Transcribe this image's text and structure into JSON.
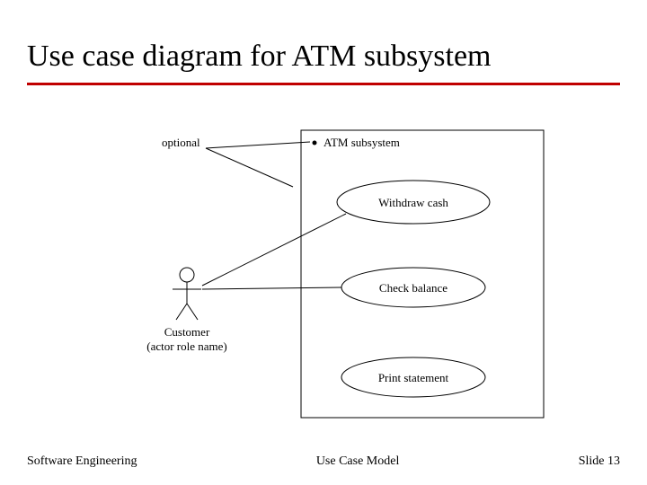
{
  "title": "Use case diagram for ATM subsystem",
  "diagram": {
    "optional_label": "optional",
    "system_name": "ATM subsystem",
    "usecase_1": "Withdraw cash",
    "usecase_2": "Check balance",
    "usecase_3": "Print statement",
    "actor_name_line1": "Customer",
    "actor_name_line2": "(actor role name)"
  },
  "footer": {
    "left": "Software Engineering",
    "center": "Use Case Model",
    "right": "Slide  13"
  }
}
